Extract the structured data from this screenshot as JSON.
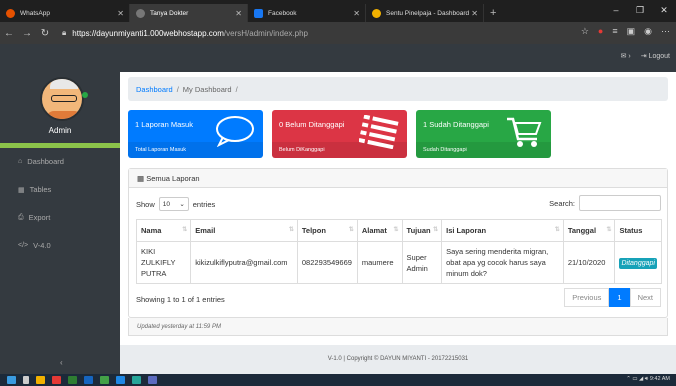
{
  "browser": {
    "tabs": [
      {
        "label": "WhatsApp",
        "color": "#e65100"
      },
      {
        "label": "Tanya Dokter",
        "color": "#555555"
      },
      {
        "label": "Facebook",
        "color": "#1877f2"
      },
      {
        "label": "Sentu Pinelpaja - Dashboard",
        "color": "#f2b100"
      }
    ],
    "url_host": "https://dayunmiyanti1.000webhostapp.com",
    "url_path": "/versH/admin/index.php"
  },
  "topbar": {
    "logout_label": "Logout"
  },
  "sidebar": {
    "admin_name": "Admin",
    "items": [
      {
        "label": "Dashboard",
        "icon": "home-icon"
      },
      {
        "label": "Tables",
        "icon": "table-icon"
      },
      {
        "label": "Export",
        "icon": "print-icon"
      },
      {
        "label": "V-4.0",
        "icon": "code-icon"
      }
    ]
  },
  "breadcrumb": {
    "link": "Dashboard",
    "current": "My Dashboard"
  },
  "cards": [
    {
      "title": "1 Laporan Masuk",
      "footer": "Total Laporan Masuk",
      "color": "#007bff",
      "icon": "comment-icon"
    },
    {
      "title": "0 Belum Ditanggapi",
      "footer": "Belum DiKanggapi",
      "color": "#dc3545",
      "icon": "list-icon"
    },
    {
      "title": "1 Sudah Ditanggapi",
      "footer": "Sudah Ditanggapi",
      "color": "#28a745",
      "icon": "cart-icon"
    }
  ],
  "panel": {
    "title": "Semua Laporan",
    "show_label": "Show",
    "entries_label": "entries",
    "page_size": "10",
    "search_label": "Search:",
    "columns": [
      "Nama",
      "Email",
      "Telpon",
      "Alamat",
      "Tujuan",
      "Isi Laporan",
      "Tanggal",
      "Status"
    ],
    "rows": [
      {
        "nama": "KIKI ZULKIFLY PUTRA",
        "email": "kikizulkiflyputra@gmail.com",
        "telpon": "082293549669",
        "alamat": "maumere",
        "tujuan": "Super Admin",
        "isi": "Saya sering menderita migran, obat apa yg cocok harus saya minum dok?",
        "tanggal": "21/10/2020",
        "status": "Ditanggapi"
      }
    ],
    "showing": "Showing 1 to 1 of 1 entries",
    "pager": {
      "prev": "Previous",
      "page": "1",
      "next": "Next"
    },
    "updated": "Updated yesterday at 11:59 PM"
  },
  "footer": {
    "text": "V-1.0 | Copyright © DAYUN MIYANTI - 20172215031"
  },
  "taskbar": {
    "time": "9:42 AM"
  }
}
